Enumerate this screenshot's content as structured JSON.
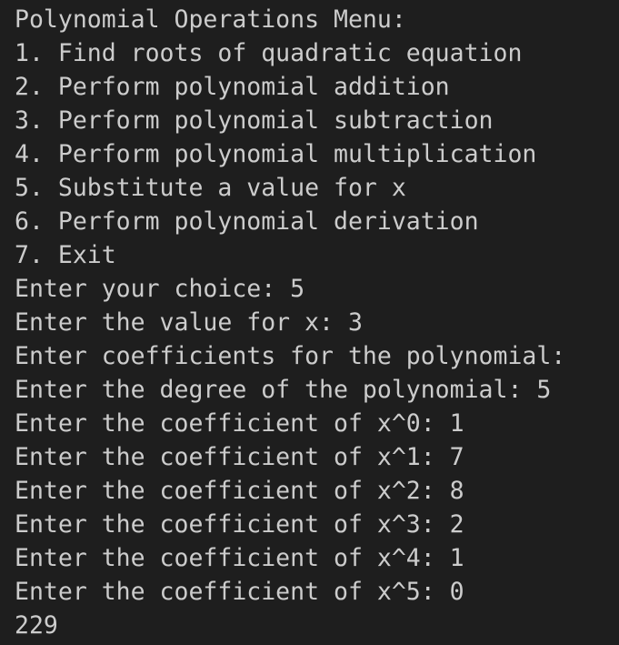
{
  "terminal": {
    "lines": [
      "Polynomial Operations Menu:",
      "1. Find roots of quadratic equation",
      "2. Perform polynomial addition",
      "3. Perform polynomial subtraction",
      "4. Perform polynomial multiplication",
      "5. Substitute a value for x",
      "6. Perform polynomial derivation",
      "7. Exit",
      "Enter your choice: 5",
      "Enter the value for x: 3",
      "Enter coefficients for the polynomial:",
      "Enter the degree of the polynomial: 5",
      "Enter the coefficient of x^0: 1",
      "Enter the coefficient of x^1: 7",
      "Enter the coefficient of x^2: 8",
      "Enter the coefficient of x^3: 2",
      "Enter the coefficient of x^4: 1",
      "Enter the coefficient of x^5: 0",
      "229"
    ]
  },
  "colors": {
    "background": "#1e1e1e",
    "text": "#cccccc"
  }
}
